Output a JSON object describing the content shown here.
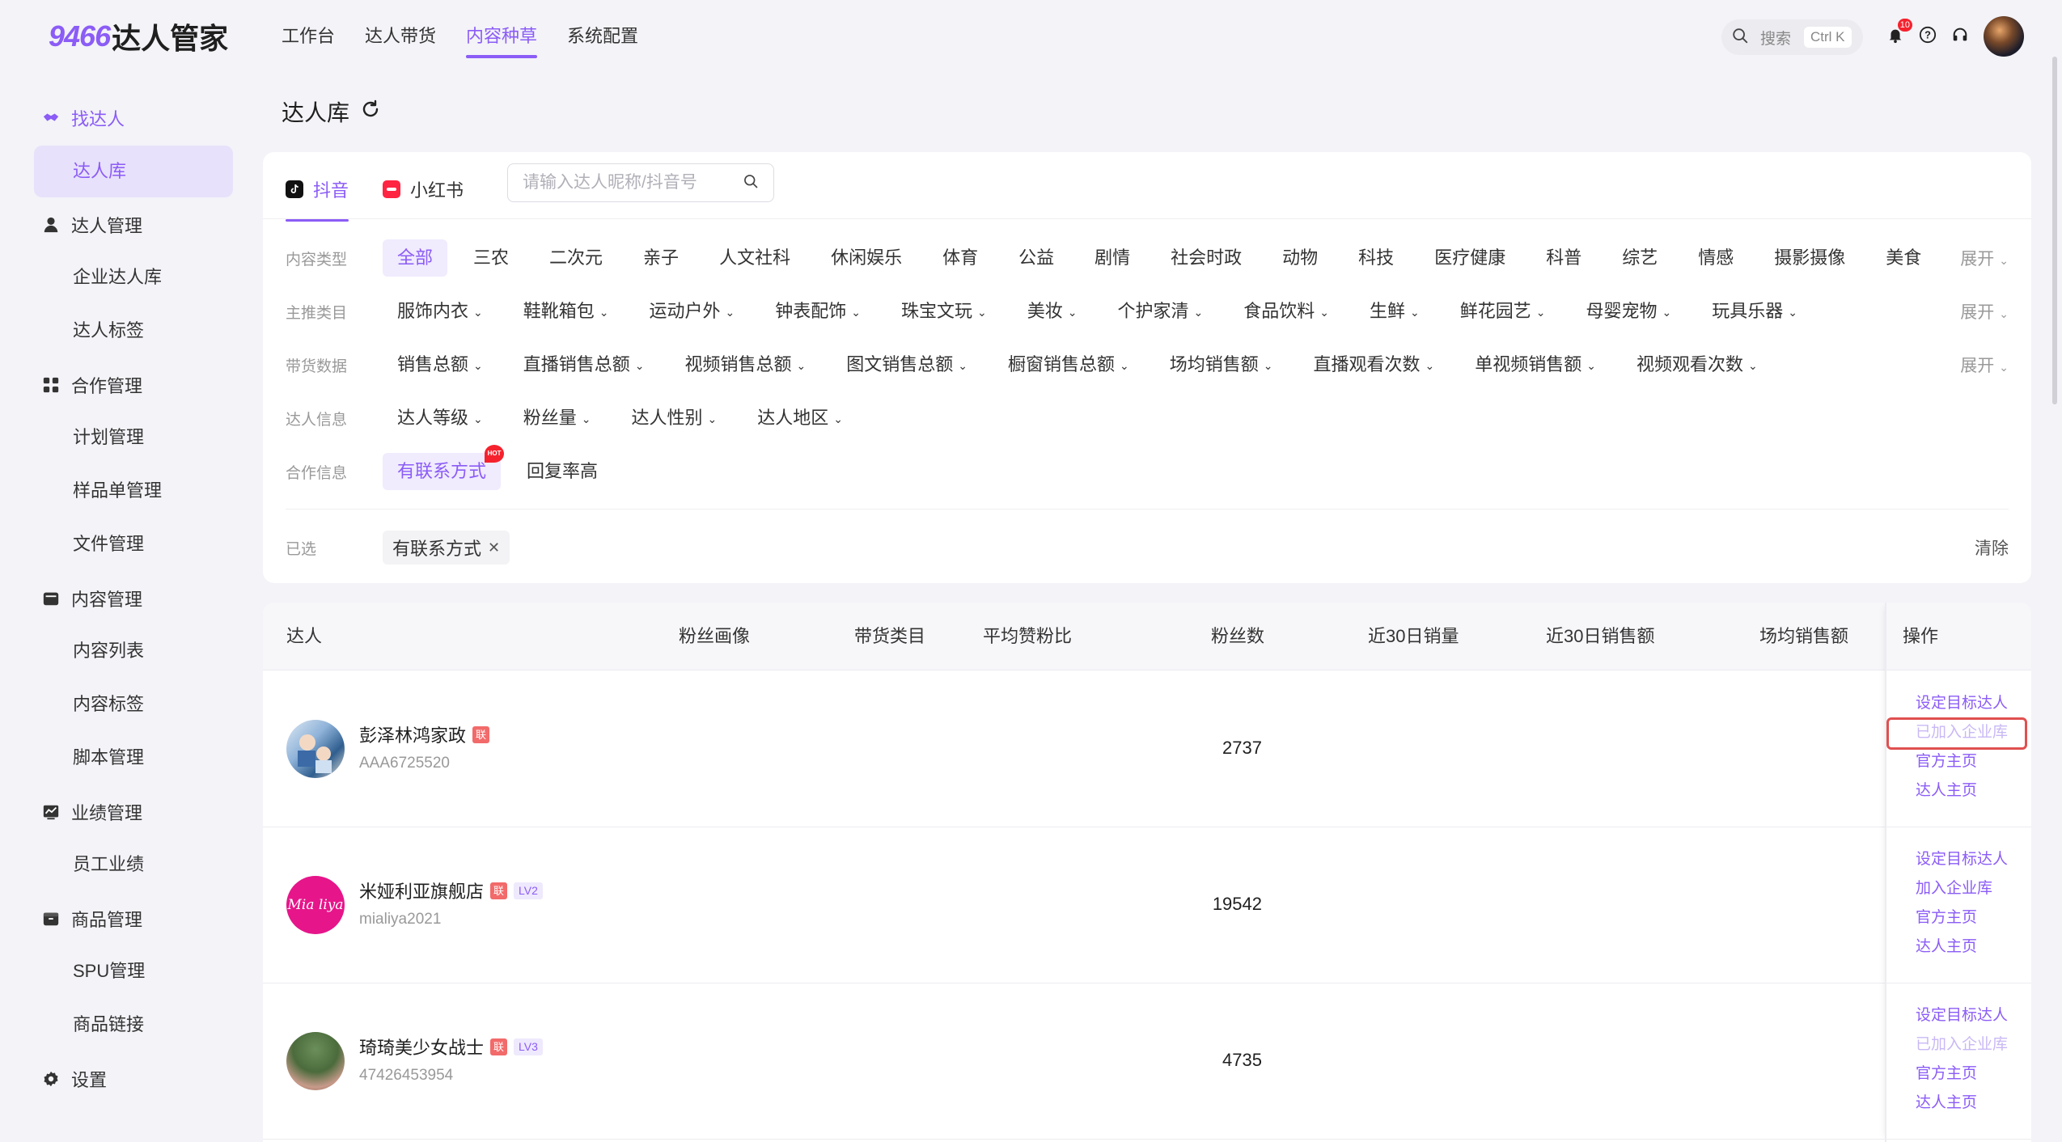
{
  "app": {
    "logo_num": "9466",
    "logo_text": "达人管家"
  },
  "nav": [
    {
      "label": "工作台"
    },
    {
      "label": "达人带货"
    },
    {
      "label": "内容种草",
      "active": true
    },
    {
      "label": "系统配置"
    }
  ],
  "topbar": {
    "search_label": "搜索",
    "search_shortcut": "Ctrl K",
    "notification_count": "10"
  },
  "sidebar": {
    "groups": [
      {
        "label": "找达人",
        "icon": "handshake-icon",
        "active": true
      },
      {
        "label": "达人管理",
        "icon": "user-icon"
      },
      {
        "label": "合作管理",
        "icon": "grid-icon"
      },
      {
        "label": "内容管理",
        "icon": "folder-icon"
      },
      {
        "label": "业绩管理",
        "icon": "chart-icon"
      },
      {
        "label": "商品管理",
        "icon": "box-icon"
      },
      {
        "label": "设置",
        "icon": "gear-icon"
      }
    ],
    "items": {
      "find": [
        {
          "label": "达人库",
          "active": true
        }
      ],
      "manage": [
        {
          "label": "企业达人库"
        },
        {
          "label": "达人标签"
        }
      ],
      "coop": [
        {
          "label": "计划管理"
        },
        {
          "label": "样品单管理"
        },
        {
          "label": "文件管理"
        }
      ],
      "content": [
        {
          "label": "内容列表"
        },
        {
          "label": "内容标签"
        },
        {
          "label": "脚本管理"
        }
      ],
      "perf": [
        {
          "label": "员工业绩"
        }
      ],
      "goods": [
        {
          "label": "SPU管理"
        },
        {
          "label": "商品链接"
        }
      ]
    }
  },
  "page": {
    "title": "达人库"
  },
  "platform_tabs": [
    {
      "label": "抖音",
      "active": true
    },
    {
      "label": "小红书"
    }
  ],
  "search": {
    "placeholder": "请输入达人昵称/抖音号"
  },
  "filters": {
    "content_type": {
      "label": "内容类型",
      "options": [
        "全部",
        "三农",
        "二次元",
        "亲子",
        "人文社科",
        "休闲娱乐",
        "体育",
        "公益",
        "剧情",
        "社会时政",
        "动物",
        "科技",
        "医疗健康",
        "科普",
        "综艺",
        "情感",
        "摄影摄像",
        "美食"
      ],
      "active_index": 0,
      "expand": "展开"
    },
    "main_category": {
      "label": "主推类目",
      "options": [
        "服饰内衣",
        "鞋靴箱包",
        "运动户外",
        "钟表配饰",
        "珠宝文玩",
        "美妆",
        "个护家清",
        "食品饮料",
        "生鲜",
        "鲜花园艺",
        "母婴宠物",
        "玩具乐器"
      ],
      "expand": "展开"
    },
    "sales_data": {
      "label": "带货数据",
      "options": [
        "销售总额",
        "直播销售总额",
        "视频销售总额",
        "图文销售总额",
        "橱窗销售总额",
        "场均销售额",
        "直播观看次数",
        "单视频销售额",
        "视频观看次数"
      ],
      "expand": "展开"
    },
    "talent_info": {
      "label": "达人信息",
      "options": [
        "达人等级",
        "粉丝量",
        "达人性别",
        "达人地区"
      ]
    },
    "cooperation": {
      "label": "合作信息",
      "options": [
        "有联系方式",
        "回复率高"
      ],
      "active_index": 0,
      "hot_label": "HOT"
    },
    "selected": {
      "label": "已选",
      "chips": [
        "有联系方式"
      ],
      "clear": "清除"
    }
  },
  "table": {
    "columns": [
      "达人",
      "粉丝画像",
      "带货类目",
      "平均赞粉比",
      "粉丝数",
      "近30日销量",
      "近30日销售额",
      "场均销售额",
      "操作"
    ],
    "rows": [
      {
        "name": "彭泽林鸿家政",
        "lian": "联",
        "level": "",
        "id": "AAA6725520",
        "fans": "2737",
        "ops": [
          "设定目标达人",
          "已加入企业库",
          "官方主页",
          "达人主页"
        ],
        "ops_disabled": [
          false,
          true,
          false,
          false
        ],
        "highlight_op": 1
      },
      {
        "name": "米娅利亚旗舰店",
        "lian": "联",
        "level": "LV2",
        "id": "mialiya2021",
        "fans": "19542",
        "avatar_text": "Mia liya",
        "ops": [
          "设定目标达人",
          "加入企业库",
          "官方主页",
          "达人主页"
        ],
        "ops_disabled": [
          false,
          false,
          false,
          false
        ]
      },
      {
        "name": "琦琦美少女战士",
        "lian": "联",
        "level": "LV3",
        "id": "47426453954",
        "fans": "4735",
        "ops": [
          "设定目标达人",
          "已加入企业库",
          "官方主页",
          "达人主页"
        ],
        "ops_disabled": [
          false,
          true,
          false,
          false
        ]
      }
    ]
  },
  "colors": {
    "accent": "#8b5cf6",
    "danger": "#f5222d",
    "highlight_border": "#e05050"
  }
}
